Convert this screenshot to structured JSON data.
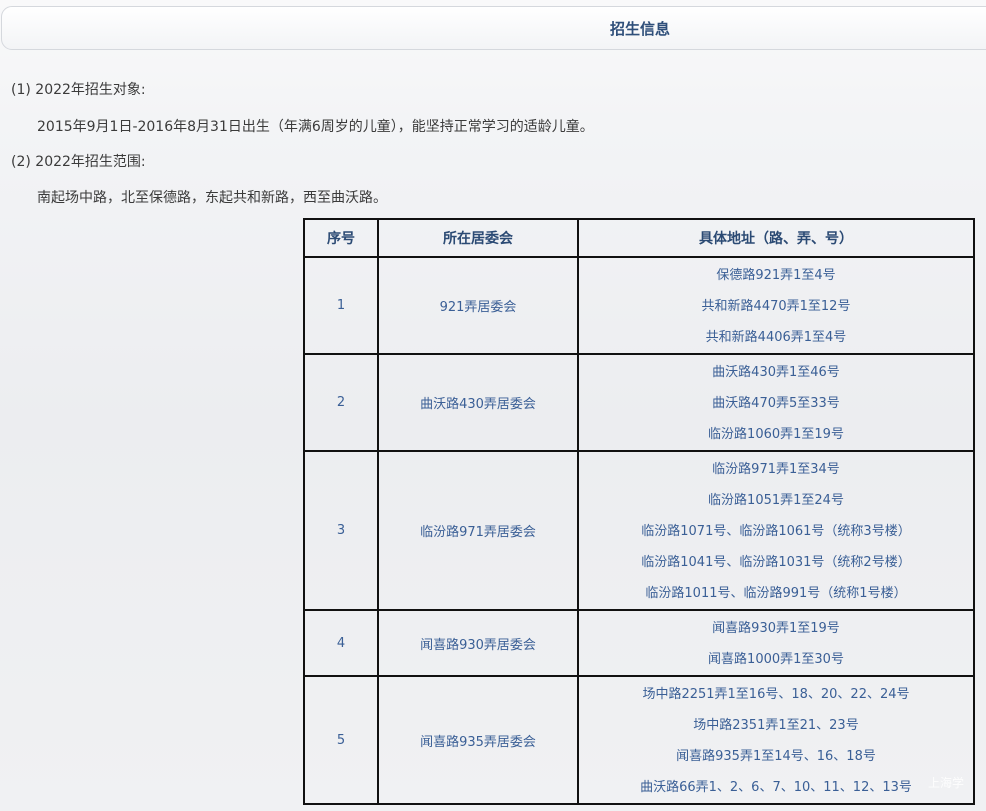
{
  "header": {
    "title": "招生信息"
  },
  "content": {
    "target_heading": "(1) 2022年招生对象:",
    "target_text": "2015年9月1日-2016年8月31日出生（年满6周岁的儿童），能坚持正常学习的适龄儿童。",
    "scope_heading": "(2) 2022年招生范围:",
    "scope_text": "南起场中路，北至保德路，东起共和新路，西至曲沃路。"
  },
  "table": {
    "headers": [
      "序号",
      "所在居委会",
      "具体地址（路、弄、号）"
    ],
    "rows": [
      {
        "no": "1",
        "committee": "921弄居委会",
        "addresses": [
          "保德路921弄1至4号",
          "共和新路4470弄1至12号",
          "共和新路4406弄1至4号"
        ]
      },
      {
        "no": "2",
        "committee": "曲沃路430弄居委会",
        "addresses": [
          "曲沃路430弄1至46号",
          "曲沃路470弄5至33号",
          "临汾路1060弄1至19号"
        ]
      },
      {
        "no": "3",
        "committee": "临汾路971弄居委会",
        "addresses": [
          "临汾路971弄1至34号",
          "临汾路1051弄1至24号",
          "临汾路1071号、临汾路1061号（统称3号楼）",
          "临汾路1041号、临汾路1031号（统称2号楼）",
          "临汾路1011号、临汾路991号（统称1号楼）"
        ]
      },
      {
        "no": "4",
        "committee": "闻喜路930弄居委会",
        "addresses": [
          "闻喜路930弄1至19号",
          "闻喜路1000弄1至30号"
        ]
      },
      {
        "no": "5",
        "committee": "闻喜路935弄居委会",
        "addresses": [
          "场中路2251弄1至16号、18、20、22、24号",
          "场中路2351弄1至21、23号",
          "闻喜路935弄1至14号、16、18号",
          "曲沃路66弄1、2、6、7、10、11、12、13号"
        ]
      }
    ]
  },
  "watermark": {
    "text": "上海学"
  }
}
